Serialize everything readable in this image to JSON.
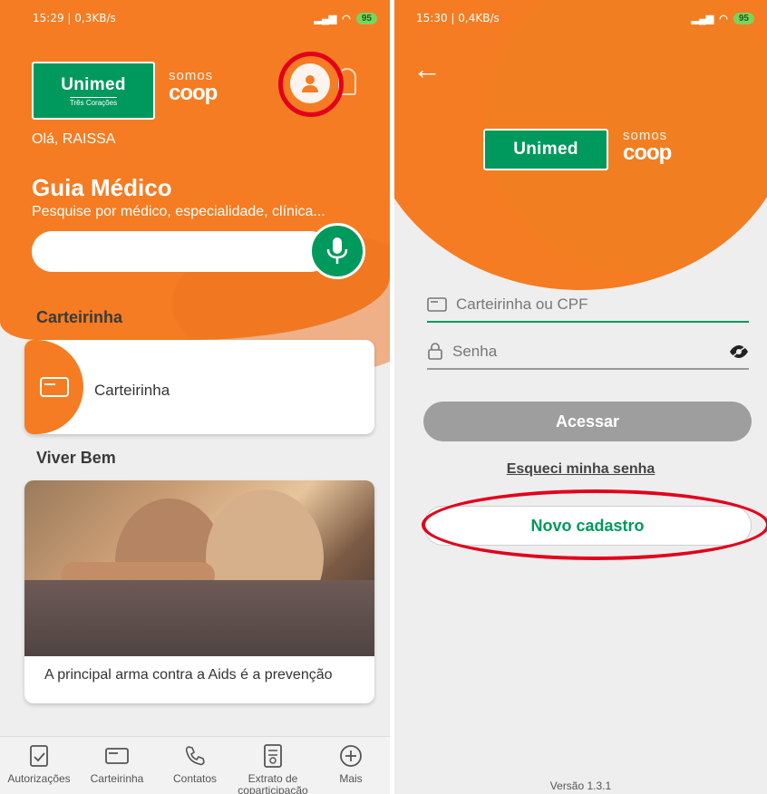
{
  "left_screen": {
    "status": {
      "time": "15:29 | 0,3KB/s",
      "battery": "95"
    },
    "logo": {
      "brand": "Unimed",
      "sub": "Três Corações"
    },
    "coop": {
      "somos": "somos",
      "word": "coop"
    },
    "greeting": "Olá, RAISSA",
    "guia": {
      "title": "Guia Médico",
      "subtitle": "Pesquise por médico, especialidade, clínica..."
    },
    "search": {
      "value": "",
      "placeholder": ""
    },
    "sections": {
      "carteirinha": "Carteirinha",
      "viver_bem": "Viver Bem"
    },
    "card_carteirinha": {
      "label": "Carteirinha"
    },
    "card_viver": {
      "caption": "A principal arma contra a Aids é a prevenção"
    },
    "bottom_nav": [
      {
        "label": "Autorizações",
        "icon": "clipboard-check-icon"
      },
      {
        "label": "Carteirinha",
        "icon": "card-icon"
      },
      {
        "label": "Contatos",
        "icon": "phone-icon"
      },
      {
        "label": "Extrato de coparticipação",
        "icon": "receipt-icon"
      },
      {
        "label": "Mais",
        "icon": "plus-circle-icon"
      }
    ],
    "colors": {
      "orange": "#f57c22",
      "green": "#00995d",
      "annotation_red": "#e3001b"
    }
  },
  "right_screen": {
    "status": {
      "time": "15:30 | 0,4KB/s",
      "battery": "95"
    },
    "logo": {
      "brand": "Unimed"
    },
    "coop": {
      "somos": "somos",
      "word": "coop"
    },
    "login": {
      "id_placeholder": "Carteirinha ou CPF",
      "password_placeholder": "Senha",
      "submit_label": "Acessar",
      "forgot_label": "Esqueci minha senha",
      "register_label": "Novo cadastro"
    },
    "version": "Versão 1.3.1"
  }
}
